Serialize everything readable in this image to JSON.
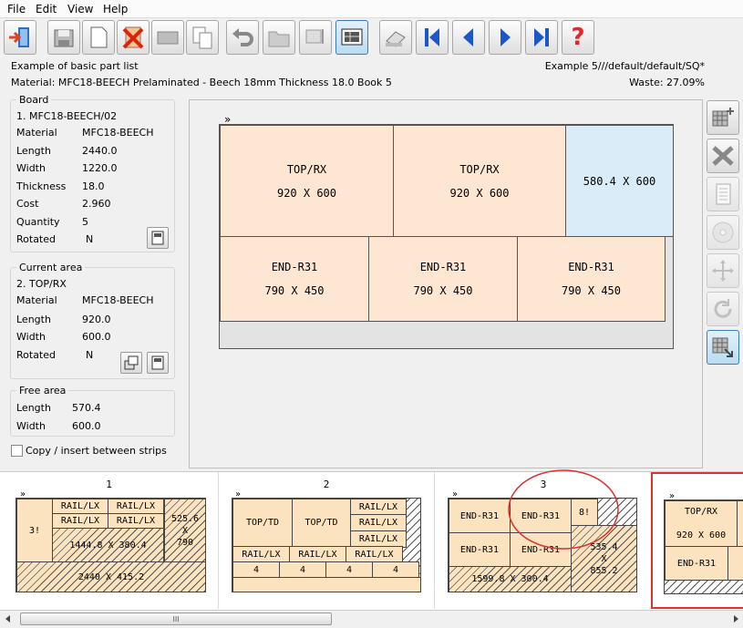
{
  "menu": [
    "File",
    "Edit",
    "View",
    "Help"
  ],
  "toolbar": {
    "buttons": [
      {
        "name": "exit-icon",
        "label": ""
      },
      {
        "name": "save-icon",
        "label": ""
      },
      {
        "name": "new-icon",
        "label": ""
      },
      {
        "name": "delete-icon",
        "label": ""
      },
      {
        "name": "board-icon",
        "label": ""
      },
      {
        "name": "copy-icon",
        "label": ""
      },
      {
        "name": "undo-icon",
        "label": ""
      },
      {
        "name": "open-icon",
        "label": ""
      },
      {
        "name": "print-setup-icon",
        "label": ""
      },
      {
        "name": "layout-view-icon",
        "label": ""
      },
      {
        "name": "eraser-icon",
        "label": ""
      },
      {
        "name": "first-icon",
        "label": ""
      },
      {
        "name": "previous-icon",
        "label": ""
      },
      {
        "name": "next-icon",
        "label": ""
      },
      {
        "name": "last-icon",
        "label": ""
      },
      {
        "name": "help-icon",
        "label": "?"
      }
    ]
  },
  "header": {
    "title": "Example of basic part list",
    "material": "Material: MFC18-BEECH Prelaminated - Beech 18mm Thickness  18.0 Book 5",
    "path": "Example 5///default/default/SQ*",
    "waste": "Waste: 27.09%"
  },
  "board": {
    "title": "Board",
    "name": "1. MFC18-BEECH/02",
    "rows": [
      {
        "label": "Material",
        "value": "MFC18-BEECH"
      },
      {
        "label": "Length",
        "value": "2440.0"
      },
      {
        "label": "Width",
        "value": "1220.0"
      },
      {
        "label": "Thickness",
        "value": "18.0"
      },
      {
        "label": "Cost",
        "value": "2.960"
      },
      {
        "label": "Quantity",
        "value": "5"
      },
      {
        "label": "Rotated",
        "value": "N"
      }
    ]
  },
  "current": {
    "title": "Current area",
    "name": "2. TOP/RX",
    "rows": [
      {
        "label": "Material",
        "value": "MFC18-BEECH"
      },
      {
        "label": "Length",
        "value": "920.0"
      },
      {
        "label": "Width",
        "value": "600.0"
      },
      {
        "label": "Rotated",
        "value": "N"
      }
    ]
  },
  "free": {
    "title": "Free area",
    "rows": [
      {
        "label": "Length",
        "value": "570.4"
      },
      {
        "label": "Width",
        "value": "600.0"
      }
    ]
  },
  "copy_label": "Copy / insert between strips",
  "sheet_marker": "»",
  "layout": {
    "pieces": [
      {
        "name": "TOP/RX",
        "size": "920 X 600"
      },
      {
        "name": "TOP/RX",
        "size": "920 X 600"
      },
      {
        "name": "",
        "size": "580.4 X 600"
      },
      {
        "name": "END-R31",
        "size": "790 X 450"
      },
      {
        "name": "END-R31",
        "size": "790 X 450"
      },
      {
        "name": "END-R31",
        "size": "790 X 450"
      }
    ]
  },
  "thumbs": {
    "t1": {
      "num": "1",
      "p": [
        "RAIL/LX",
        "RAIL/LX",
        "RAIL/LX",
        "RAIL/LX",
        "3!",
        "525.6\nX\n790",
        "1444.8 X 380.4",
        "2440 X 415.2"
      ]
    },
    "t2": {
      "num": "2",
      "p": [
        "TOP/TD",
        "TOP/TD",
        "RAIL/LX",
        "RAIL/LX",
        "RAIL/LX",
        "RAIL/LX",
        "RAIL/LX",
        "RAIL/LX",
        "4",
        "4",
        "4",
        "4"
      ]
    },
    "t3": {
      "num": "3",
      "p": [
        "END-R31",
        "END-R31",
        "8!",
        "END-R31",
        "END-R31",
        "535.4\nX\n855.2",
        "1599.8 X 300.4"
      ]
    },
    "t4": {
      "p": [
        "TOP/RX",
        "920 X 600",
        "END-R31",
        "E"
      ]
    }
  },
  "scroll_grip": "III",
  "colors": {
    "piece": "#fde6d2",
    "free": "#d9ecf8",
    "highlight": "#e03030",
    "accent": "#3b7bbf"
  }
}
